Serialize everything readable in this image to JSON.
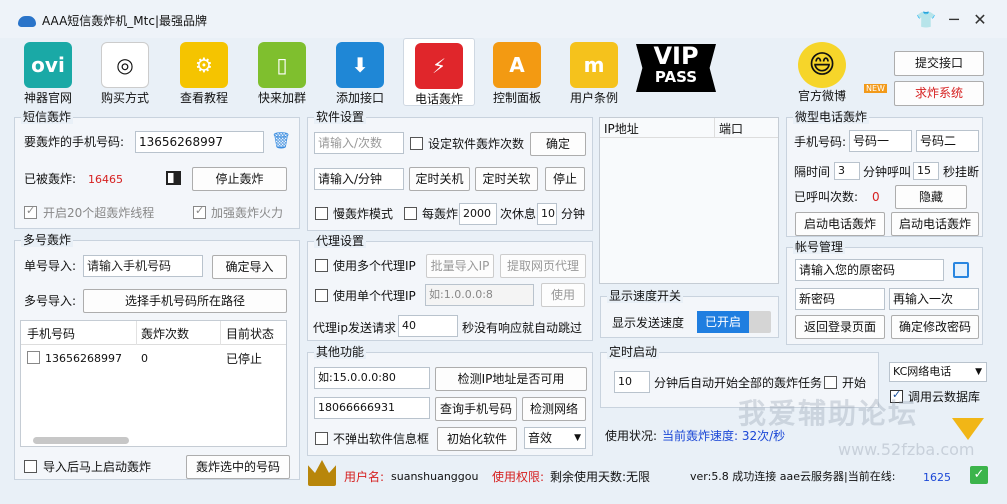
{
  "window": {
    "title": "AAA短信轰炸机_Mtc|最强品牌"
  },
  "toolbar": [
    {
      "label": "神器官网",
      "icon": "ovi-icon",
      "icon_text": "ovi",
      "color": "#1aa9a6"
    },
    {
      "label": "购买方式",
      "icon": "shutter-icon",
      "icon_text": "◎",
      "color": "#ffffff"
    },
    {
      "label": "查看教程",
      "icon": "gear-icon",
      "icon_text": "⚙",
      "color": "#f5c400"
    },
    {
      "label": "快来加群",
      "icon": "phone-icon",
      "icon_text": "▯",
      "color": "#7fbf2e"
    },
    {
      "label": "添加接口",
      "icon": "download-icon",
      "icon_text": "⬇",
      "color": "#1f87d6"
    },
    {
      "label": "电话轰炸",
      "icon": "power-icon",
      "icon_text": "⚡",
      "color": "#e0262b"
    },
    {
      "label": "控制面板",
      "icon": "avast-icon",
      "icon_text": "A",
      "color": "#f39a12"
    },
    {
      "label": "用户条例",
      "icon": "m-icon",
      "icon_text": "m",
      "color": "#f5c21c"
    }
  ],
  "vip": {
    "line1": "VIP",
    "line2": "PASS"
  },
  "weibo": {
    "label": "官方微博",
    "new": "NEW"
  },
  "actions": {
    "submit": "提交接口",
    "request": "求炸系统"
  },
  "sms": {
    "title": "短信轰炸",
    "phone_label": "要轰炸的手机号码:",
    "phone": "13656268997",
    "bombed_label": "已被轰炸:",
    "bombed_count": "16465",
    "stop": "停止轰炸",
    "opt1": "开启20个超轰炸线程",
    "opt2": "加强轰炸火力"
  },
  "multi": {
    "title": "多号轰炸",
    "single_label": "单号导入:",
    "single_ph": "请输入手机号码",
    "confirm_import": "确定导入",
    "multi_label": "多号导入:",
    "choose_path": "选择手机号码所在路径",
    "headers": [
      "手机号码",
      "轰炸次数",
      "目前状态"
    ],
    "rows": [
      {
        "phone": "13656268997",
        "count": "0",
        "status": "已停止"
      }
    ],
    "auto_start": "导入后马上启动轰炸",
    "bomb_selected": "轰炸选中的号码"
  },
  "soft": {
    "title": "软件设置",
    "times_ph": "请输入/次数",
    "set_times": "设定软件轰炸次数",
    "ok": "确定",
    "min_ph": "请输入/分钟",
    "shutdown": "定时关机",
    "close": "定时关软",
    "stop": "停止",
    "slow": "慢轰炸模式",
    "every": "每轰炸",
    "every_val": "2000",
    "rest": "次休息",
    "rest_val": "10",
    "minute": "分钟"
  },
  "proxy": {
    "title": "代理设置",
    "multi": "使用多个代理IP",
    "batch": "批量导入IP",
    "fetch": "提取网页代理",
    "single": "使用单个代理IP",
    "ip_ph": "如:1.0.0.0:8",
    "use": "使用",
    "send_label": "代理ip发送请求",
    "send_val": "40",
    "send_tail": "秒没有响应就自动跳过"
  },
  "other": {
    "title": "其他功能",
    "ip_example": "如:15.0.0.0:80",
    "check_ip": "检测IP地址是否可用",
    "phone": "18066666931",
    "query": "查询手机号码",
    "check_net": "检测网络",
    "no_popup": "不弹出软件信息框",
    "init": "初始化软件",
    "sound": "音效"
  },
  "iplist": {
    "h_ip": "IP地址",
    "h_port": "端口"
  },
  "speed": {
    "title": "显示速度开关",
    "label": "显示发送速度",
    "toggle": "已开启"
  },
  "timer": {
    "title": "定时启动",
    "minutes": "10",
    "text": "分钟后自动开始全部的轰炸任务",
    "start": "开始"
  },
  "usage": {
    "label": "使用状况:",
    "status": "当前轰炸速度: 32次/秒"
  },
  "micro": {
    "title": "微型电话轰炸",
    "phone_label": "手机号码:",
    "num1": "号码一",
    "num2": "号码二",
    "interval_label": "隔时间",
    "interval": "3",
    "call_label": "分钟呼叫",
    "call": "15",
    "hangup": "秒挂断",
    "called_label": "已呼叫次数:",
    "called": "0",
    "hide": "隐藏",
    "start1": "启动电话轰炸",
    "start2": "启动电话轰炸"
  },
  "account": {
    "title": "帐号管理",
    "old_ph": "请输入您的原密码",
    "new_ph": "新密码",
    "again_ph": "再输入一次",
    "back": "返回登录页面",
    "confirm": "确定修改密码"
  },
  "network": {
    "select": "KC网络电话",
    "cloud": "调用云数据库"
  },
  "status": {
    "user_label": "用户名:",
    "user": "suanshuanggou",
    "perm_label": "使用权限:",
    "perm": "剩余使用天数:无限",
    "version": "ver:5.8 成功连接 aae云服务器|当前在线:",
    "online": "1625"
  },
  "watermark": {
    "line1": "我爱辅助论坛",
    "line2": "www.52fzba.com"
  },
  "colors": {
    "accent": "#1b47d6",
    "red": "#d62020",
    "toggle": "#1f7ee0"
  }
}
